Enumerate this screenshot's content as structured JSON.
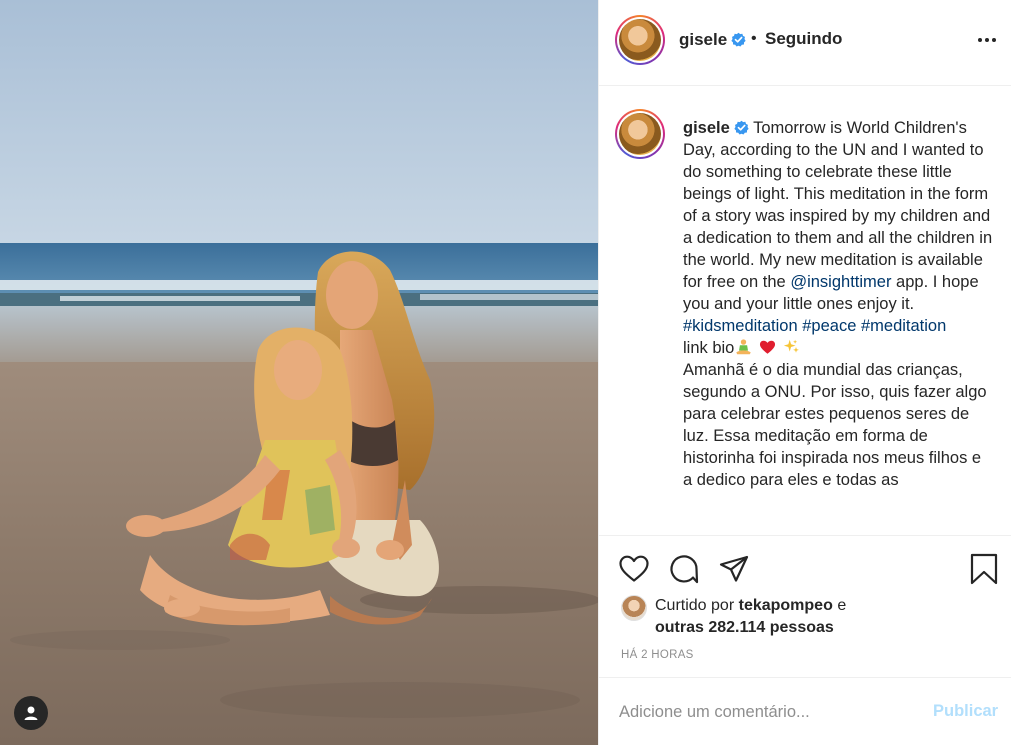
{
  "header": {
    "username": "gisele",
    "separator": "•",
    "follow_status": "Seguindo"
  },
  "caption": {
    "username": "gisele",
    "text_en_1": "Tomorrow is World Children's Day, according to the UN and I wanted to do something to celebrate these little beings of light. This meditation in the form of a story was inspired by my children and a dedication to them and all the children in the world. My new meditation is available for free on the",
    "mention": "@insighttimer",
    "text_en_2": "app. I hope you and your little ones enjoy it.",
    "hashtag_1": "#kidsmeditation",
    "hashtag_2": "#peace",
    "hashtag_3": "#meditation",
    "link_bio": "link bio",
    "text_pt": "Amanhã é o dia mundial das crianças, segundo a ONU. Por isso, quis fazer algo para celebrar estes pequenos seres de luz. Essa meditação em forma de historinha foi inspirada nos meus filhos e a dedico para eles e todas as"
  },
  "likes": {
    "prefix": "Curtido por",
    "liker": "tekapompeo",
    "conj": "e",
    "others": "outras 282.114 pessoas"
  },
  "timestamp": "HÁ 2 HORAS",
  "comment": {
    "placeholder": "Adicione um comentário...",
    "publish_label": "Publicar"
  },
  "icons": {
    "verified": "verified-badge-icon",
    "like": "heart-icon",
    "comment": "comment-bubble-icon",
    "share": "paper-plane-icon",
    "save": "bookmark-icon",
    "more": "more-options-icon",
    "tag": "user-tag-icon",
    "emoji_1": "meditating-person-emoji",
    "emoji_2": "red-heart-emoji",
    "emoji_3": "sparkles-emoji"
  },
  "colors": {
    "link": "#00376b",
    "verified": "#3897f0",
    "publish_disabled": "#b2dffc",
    "muted": "#8e8e8e"
  }
}
